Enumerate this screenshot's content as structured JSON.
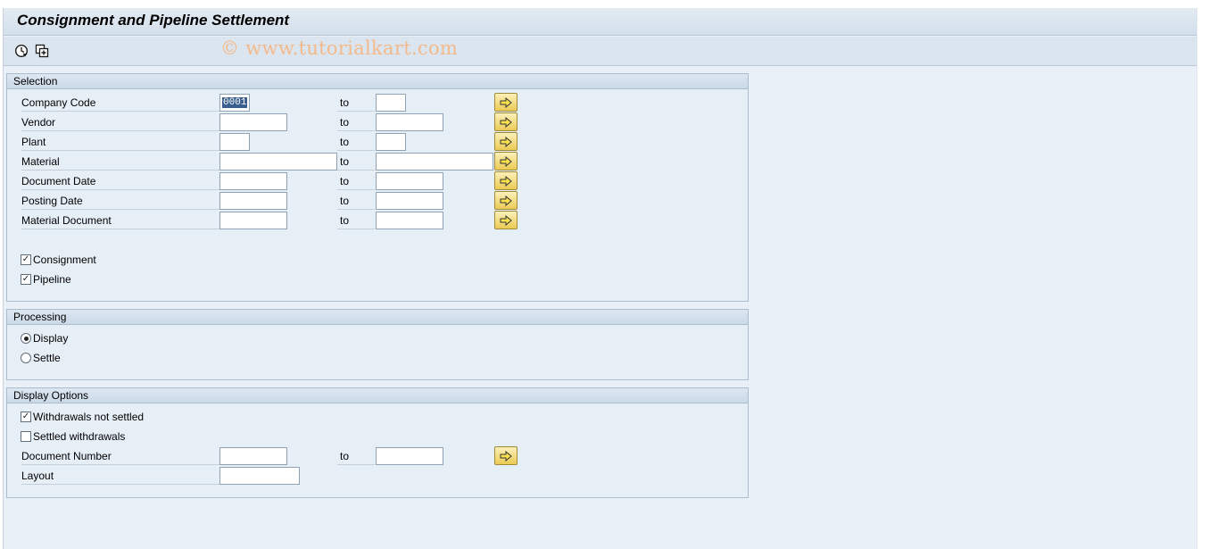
{
  "window": {
    "title": "Consignment and Pipeline Settlement"
  },
  "toolbar": {
    "watermark": "© www.tutorialkart.com",
    "execute_icon": "execute-icon",
    "variant_icon": "get-variant-icon"
  },
  "selection": {
    "header": "Selection",
    "to_label": "to",
    "rows": [
      {
        "label": "Company Code",
        "from": "0001",
        "to": ""
      },
      {
        "label": "Vendor",
        "from": "",
        "to": ""
      },
      {
        "label": "Plant",
        "from": "",
        "to": ""
      },
      {
        "label": "Material",
        "from": "",
        "to": ""
      },
      {
        "label": "Document Date",
        "from": "",
        "to": ""
      },
      {
        "label": "Posting Date",
        "from": "",
        "to": ""
      },
      {
        "label": "Material Document",
        "from": "",
        "to": ""
      }
    ],
    "consignment": {
      "label": "Consignment",
      "checked": true
    },
    "pipeline": {
      "label": "Pipeline",
      "checked": true
    }
  },
  "processing": {
    "header": "Processing",
    "display": {
      "label": "Display",
      "selected": true
    },
    "settle": {
      "label": "Settle",
      "selected": false
    }
  },
  "display_options": {
    "header": "Display Options",
    "withdrawals_not_settled": {
      "label": "Withdrawals not settled",
      "checked": true
    },
    "settled_withdrawals": {
      "label": "Settled withdrawals",
      "checked": false
    },
    "document_number": {
      "label": "Document Number",
      "from": "",
      "to": ""
    },
    "to_label": "to",
    "layout": {
      "label": "Layout",
      "value": ""
    }
  },
  "colors": {
    "background": "#eaf0f7",
    "group_border": "#a9bcd0",
    "multi_button": "#eccb55",
    "watermark": "#f3b98a"
  }
}
